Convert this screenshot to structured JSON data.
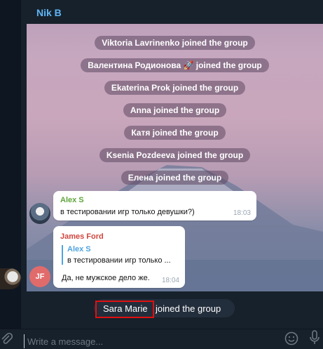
{
  "chat": {
    "title": "Nik B",
    "service_messages": [
      {
        "text": "Viktoria Lavrinenko joined the group"
      },
      {
        "text": "Валентина Родионова 🚀 joined the group"
      },
      {
        "text": "Ekaterina Prok joined the group"
      },
      {
        "text": "Anna joined the group"
      },
      {
        "text": "Катя joined the group"
      },
      {
        "text": "Ksenia Pozdeeva joined the group"
      },
      {
        "text": "Елена joined the group"
      }
    ],
    "messages": [
      {
        "sender": "Alex S",
        "sender_color": "#5ea53b",
        "text": "в тестировании игр только девушки?)",
        "time": "18:03"
      },
      {
        "sender": "James Ford",
        "sender_color": "#d0453d",
        "reply_sender": "Alex S",
        "reply_text": "в тестировании игр только ...",
        "text": "Да, не мужское дело же.",
        "time": "18:04",
        "avatar_initials": "JF"
      }
    ]
  },
  "bottom_service": {
    "name": "Sara Marie",
    "rest": "joined the group"
  },
  "composer": {
    "placeholder": "Write a message..."
  },
  "colors": {
    "accent": "#5eb5f7",
    "highlight": "#e01010"
  }
}
